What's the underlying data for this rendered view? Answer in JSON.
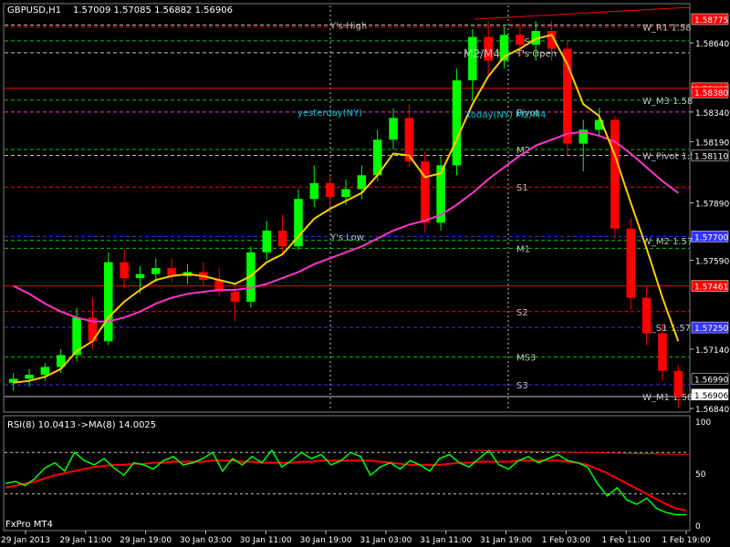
{
  "header": {
    "symbol_tf": "GBPUSD,H1",
    "ohlc": "1.57009 1.57085 1.56882 1.56906"
  },
  "rsi_header": {
    "label": "RSI(8) 10.0413",
    "ma_label": "->MA(8) 14.0025"
  },
  "footer": {
    "broker": "FxPro MT4"
  },
  "colors": {
    "bg": "#000000",
    "grid": "#606060",
    "bull": "#00ff00",
    "bear": "#ff0000",
    "ma_fast": "#ffcc00",
    "ma_slow": "#ff33cc",
    "rsi_line": "#00ff00",
    "rsi_ma": "#ff0000",
    "pivot_white": "#c0c0c0",
    "pivot_red": "#ff0000",
    "pivot_green": "#00cc00",
    "pivot_blue": "#3333ff"
  },
  "chart_data": [
    {
      "type": "candlestick",
      "symbol": "GBPUSD",
      "timeframe": "H1",
      "ylim": [
        1.5684,
        1.5887
      ],
      "price_ticks": [
        1.5869,
        1.5834,
        1.5819,
        1.5788,
        1.5759,
        1.5714,
        1.5684
      ],
      "price_tick_labels": [
        "1.58640",
        "1.58340",
        "1.58190",
        "1.57890",
        "1.57590",
        "1.57140",
        "1.56840"
      ],
      "price_tags": [
        {
          "label": "1.58775",
          "price": 1.5881,
          "color": "#ff0000"
        },
        {
          "label": "1.58443",
          "price": 1.5846,
          "color": "#ff0000"
        },
        {
          "label": "1.58380",
          "price": 1.5844,
          "color": "#ff0000"
        },
        {
          "label": "1.58110",
          "price": 1.5812,
          "color": "#000000"
        },
        {
          "label": "1.57700",
          "price": 1.5771,
          "color": "#3333ff"
        },
        {
          "label": "1.57461",
          "price": 1.5746,
          "color": "#ff0000"
        },
        {
          "label": "1.57250",
          "price": 1.5725,
          "color": "#3333ff"
        },
        {
          "label": "1.56990",
          "price": 1.5699,
          "color": "#000000"
        },
        {
          "label": "1.56906",
          "price": 1.5691,
          "color": "#ffffff"
        }
      ],
      "time_labels": [
        "29 Jan 2013",
        "29 Jan 11:00",
        "29 Jan 19:00",
        "30 Jan 03:00",
        "30 Jan 11:00",
        "30 Jan 19:00",
        "31 Jan 03:00",
        "31 Jan 11:00",
        "31 Jan 19:00",
        "1 Feb 03:00",
        "1 Feb 11:00",
        "1 Feb 19:00"
      ],
      "candles": [
        {
          "o": 1.5697,
          "h": 1.5702,
          "l": 1.5693,
          "c": 1.5699
        },
        {
          "o": 1.5699,
          "h": 1.5704,
          "l": 1.5695,
          "c": 1.5701
        },
        {
          "o": 1.5701,
          "h": 1.5707,
          "l": 1.5698,
          "c": 1.5705
        },
        {
          "o": 1.5705,
          "h": 1.5714,
          "l": 1.5702,
          "c": 1.5711
        },
        {
          "o": 1.5711,
          "h": 1.5735,
          "l": 1.5708,
          "c": 1.573
        },
        {
          "o": 1.573,
          "h": 1.574,
          "l": 1.5714,
          "c": 1.5718
        },
        {
          "o": 1.5718,
          "h": 1.5763,
          "l": 1.5716,
          "c": 1.5758
        },
        {
          "o": 1.5758,
          "h": 1.5765,
          "l": 1.5745,
          "c": 1.575
        },
        {
          "o": 1.575,
          "h": 1.5756,
          "l": 1.5742,
          "c": 1.5752
        },
        {
          "o": 1.5752,
          "h": 1.576,
          "l": 1.5748,
          "c": 1.5755
        },
        {
          "o": 1.5755,
          "h": 1.576,
          "l": 1.5748,
          "c": 1.5751
        },
        {
          "o": 1.5751,
          "h": 1.5757,
          "l": 1.5747,
          "c": 1.5753
        },
        {
          "o": 1.5753,
          "h": 1.5758,
          "l": 1.5746,
          "c": 1.5749
        },
        {
          "o": 1.5749,
          "h": 1.5755,
          "l": 1.5741,
          "c": 1.5743
        },
        {
          "o": 1.5743,
          "h": 1.5747,
          "l": 1.5728,
          "c": 1.5738
        },
        {
          "o": 1.5738,
          "h": 1.5766,
          "l": 1.5735,
          "c": 1.5763
        },
        {
          "o": 1.5763,
          "h": 1.5779,
          "l": 1.5759,
          "c": 1.5774
        },
        {
          "o": 1.5774,
          "h": 1.5782,
          "l": 1.5762,
          "c": 1.5766
        },
        {
          "o": 1.5766,
          "h": 1.5795,
          "l": 1.5764,
          "c": 1.579
        },
        {
          "o": 1.579,
          "h": 1.5807,
          "l": 1.5786,
          "c": 1.5798
        },
        {
          "o": 1.5798,
          "h": 1.5802,
          "l": 1.5786,
          "c": 1.5791
        },
        {
          "o": 1.5791,
          "h": 1.58,
          "l": 1.5787,
          "c": 1.5795
        },
        {
          "o": 1.5795,
          "h": 1.5807,
          "l": 1.579,
          "c": 1.5802
        },
        {
          "o": 1.5802,
          "h": 1.5825,
          "l": 1.5799,
          "c": 1.582
        },
        {
          "o": 1.582,
          "h": 1.5836,
          "l": 1.5815,
          "c": 1.5831
        },
        {
          "o": 1.5831,
          "h": 1.5838,
          "l": 1.5806,
          "c": 1.5809
        },
        {
          "o": 1.5809,
          "h": 1.5814,
          "l": 1.5773,
          "c": 1.5778
        },
        {
          "o": 1.5778,
          "h": 1.5812,
          "l": 1.5774,
          "c": 1.5807
        },
        {
          "o": 1.5807,
          "h": 1.5856,
          "l": 1.5802,
          "c": 1.585
        },
        {
          "o": 1.585,
          "h": 1.5876,
          "l": 1.584,
          "c": 1.5872
        },
        {
          "o": 1.5872,
          "h": 1.588,
          "l": 1.5852,
          "c": 1.586
        },
        {
          "o": 1.586,
          "h": 1.5877,
          "l": 1.5856,
          "c": 1.5873
        },
        {
          "o": 1.5873,
          "h": 1.5879,
          "l": 1.5862,
          "c": 1.5868
        },
        {
          "o": 1.5868,
          "h": 1.588,
          "l": 1.586,
          "c": 1.5875
        },
        {
          "o": 1.5875,
          "h": 1.588,
          "l": 1.586,
          "c": 1.5866
        },
        {
          "o": 1.5866,
          "h": 1.587,
          "l": 1.5812,
          "c": 1.5818
        },
        {
          "o": 1.5818,
          "h": 1.583,
          "l": 1.5804,
          "c": 1.5825
        },
        {
          "o": 1.5825,
          "h": 1.5836,
          "l": 1.5822,
          "c": 1.583
        },
        {
          "o": 1.583,
          "h": 1.5832,
          "l": 1.577,
          "c": 1.5775
        },
        {
          "o": 1.5775,
          "h": 1.578,
          "l": 1.5734,
          "c": 1.574
        },
        {
          "o": 1.574,
          "h": 1.5746,
          "l": 1.5716,
          "c": 1.5722
        },
        {
          "o": 1.5722,
          "h": 1.5727,
          "l": 1.5698,
          "c": 1.5703
        },
        {
          "o": 1.5703,
          "h": 1.5706,
          "l": 1.5684,
          "c": 1.569
        }
      ],
      "ma_fast": [
        1.5697,
        1.5698,
        1.57,
        1.5704,
        1.5713,
        1.5718,
        1.573,
        1.5738,
        1.5744,
        1.5749,
        1.5751,
        1.5752,
        1.5751,
        1.5749,
        1.5747,
        1.5751,
        1.5758,
        1.5762,
        1.5771,
        1.578,
        1.5785,
        1.5789,
        1.5793,
        1.5802,
        1.5813,
        1.5812,
        1.5801,
        1.5803,
        1.582,
        1.5838,
        1.5852,
        1.5862,
        1.5866,
        1.5871,
        1.5873,
        1.5858,
        1.5838,
        1.5832,
        1.5812,
        1.5788,
        1.5765,
        1.574,
        1.5718
      ],
      "ma_slow": [
        1.5746,
        1.5742,
        1.5737,
        1.5733,
        1.573,
        1.5728,
        1.5728,
        1.573,
        1.5733,
        1.5737,
        1.574,
        1.5742,
        1.5743,
        1.5744,
        1.5744,
        1.5745,
        1.5747,
        1.575,
        1.5753,
        1.5757,
        1.576,
        1.5763,
        1.5766,
        1.577,
        1.5774,
        1.5777,
        1.5779,
        1.5782,
        1.5787,
        1.5793,
        1.58,
        1.5806,
        1.5812,
        1.5817,
        1.582,
        1.5823,
        1.5824,
        1.5822,
        1.5819,
        1.5813,
        1.5806,
        1.5799,
        1.5793
      ],
      "trendline": {
        "from_price": 1.5881,
        "to_price": 1.5887
      },
      "levels": [
        {
          "name": "R1",
          "label": "W_R1 1.58",
          "price": 1.5877,
          "color": "#ff0000",
          "style": "dash"
        },
        {
          "name": "Ys High",
          "label": "Y's High",
          "price": 1.5878,
          "color": "#c0c0c0",
          "style": "dash"
        },
        {
          "name": "MS",
          "label": "MS",
          "price": 1.587,
          "color": "#00cc00",
          "style": "dash"
        },
        {
          "name": "T's Open",
          "label": "T's Open",
          "price": 1.5864,
          "color": "#c0c0c0",
          "style": "dash"
        },
        {
          "name": "red_line_1",
          "label": "",
          "price": 1.5846,
          "color": "#ff0000",
          "style": "solid"
        },
        {
          "name": "W_M3",
          "label": "W_M3 1.58",
          "price": 1.584,
          "color": "#00cc00",
          "style": "dash"
        },
        {
          "name": "Pivot",
          "label": "Pivot",
          "price": 1.5834,
          "color": "#ff33cc",
          "style": "dash"
        },
        {
          "name": "M2",
          "label": "M2",
          "price": 1.5815,
          "color": "#00cc00",
          "style": "dash"
        },
        {
          "name": "W_Pivot",
          "label": "W_Pivot 1.5",
          "price": 1.5812,
          "color": "#c0c0c0",
          "style": "dash"
        },
        {
          "name": "S1",
          "label": "S1",
          "price": 1.5796,
          "color": "#ff0000",
          "style": "dash"
        },
        {
          "name": "Ys Low",
          "label": "Y's Low",
          "price": 1.5771,
          "color": "#3333ff",
          "style": "dash"
        },
        {
          "name": "W_M2",
          "label": "W_M2 1.57",
          "price": 1.5769,
          "color": "#00cc00",
          "style": "dash"
        },
        {
          "name": "M1",
          "label": "M1",
          "price": 1.5765,
          "color": "#00cc00",
          "style": "dash"
        },
        {
          "name": "red_line_2",
          "label": "",
          "price": 1.5746,
          "color": "#ff0000",
          "style": "solid"
        },
        {
          "name": "S2",
          "label": "S2",
          "price": 1.5733,
          "color": "#ff0000",
          "style": "dash"
        },
        {
          "name": "W_S1",
          "label": "W_S1 1.57",
          "price": 1.5725,
          "color": "#3333ff",
          "style": "dash"
        },
        {
          "name": "MS3",
          "label": "MS3",
          "price": 1.571,
          "color": "#00cc00",
          "style": "dash"
        },
        {
          "name": "S3",
          "label": "S3",
          "price": 1.5696,
          "color": "#3333ff",
          "style": "dash"
        },
        {
          "name": "W_M1",
          "label": "W_M1 1.58",
          "price": 1.569,
          "color": "#c0c0c0",
          "style": "solid"
        }
      ],
      "annotations": [
        {
          "text": "M2/M4",
          "price": 1.5869
        },
        {
          "text": "yesterday(NY)",
          "price": 1.5834
        },
        {
          "text": "today(NY) M2/M4",
          "price": 1.5833
        }
      ]
    },
    {
      "type": "line",
      "name": "RSI(8)",
      "ylim": [
        0,
        100
      ],
      "y_ticks": [
        0,
        50,
        100
      ],
      "levels": [
        30,
        70
      ],
      "series": [
        {
          "name": "RSI(8)",
          "values": [
            40,
            42,
            38,
            45,
            55,
            60,
            52,
            70,
            62,
            58,
            64,
            55,
            48,
            60,
            58,
            54,
            62,
            66,
            58,
            60,
            64,
            70,
            52,
            64,
            58,
            66,
            60,
            72,
            56,
            62,
            70,
            64,
            68,
            58,
            62,
            70,
            66,
            48,
            56,
            60,
            54,
            62,
            58,
            52,
            64,
            68,
            60,
            56,
            64,
            72,
            58,
            54,
            62,
            66,
            60,
            64,
            68,
            62,
            60,
            56,
            40,
            28,
            36,
            24,
            20,
            26,
            16,
            12,
            10,
            10
          ]
        },
        {
          "name": "MA(8)",
          "values": [
            36,
            38,
            40,
            42,
            45,
            48,
            50,
            52,
            54,
            56,
            57,
            58,
            58,
            59,
            59,
            60,
            60,
            61,
            61,
            61,
            61,
            62,
            62,
            62,
            61,
            61,
            60,
            60,
            60,
            60,
            61,
            61,
            62,
            62,
            62,
            62,
            62,
            62,
            61,
            60,
            59,
            58,
            58,
            58,
            58,
            59,
            60,
            60,
            61,
            61,
            61,
            61,
            62,
            62,
            62,
            62,
            62,
            61,
            60,
            58,
            54,
            50,
            45,
            40,
            35,
            30,
            25,
            20,
            16,
            14
          ]
        }
      ],
      "trendline": {
        "from": 72,
        "to": 68
      }
    }
  ]
}
